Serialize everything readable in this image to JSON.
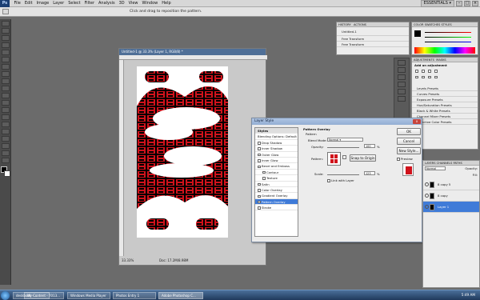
{
  "menubar": {
    "logo": "Ps",
    "items": [
      "File",
      "Edit",
      "Image",
      "Layer",
      "Select",
      "Filter",
      "Analysis",
      "3D",
      "View",
      "Window",
      "Help"
    ],
    "workspace": "ESSENTIALS ▾",
    "win_min": "–",
    "win_max": "□",
    "win_close": "×"
  },
  "optionsbar": {
    "hint": "Click and drag to reposition the pattern."
  },
  "history": {
    "tabs": [
      "HISTORY",
      "ACTIONS"
    ],
    "items": [
      "Untitled-1",
      "Free Transform",
      "Free Transform"
    ]
  },
  "color_panel": {
    "tabs": [
      "COLOR",
      "SWATCHES",
      "STYLES"
    ]
  },
  "adjust_panel": {
    "tabs": [
      "ADJUSTMENTS",
      "MASKS"
    ],
    "header": "Add an adjustment",
    "presets": [
      "Levels Presets",
      "Curves Presets",
      "Exposure Presets",
      "Hue/Saturation Presets",
      "Black & White Presets",
      "Channel Mixer Presets",
      "Selective Color Presets"
    ]
  },
  "document": {
    "title": "Untitled-1 @ 33.3% (Layer 1, RGB/8) *",
    "zoom": "33.33%",
    "docinfo": "Doc: 17.2M/8.98M"
  },
  "layer_style": {
    "title": "Layer Style",
    "close": "x",
    "styles": [
      "Styles",
      "Blending Options: Default",
      "Drop Shadow",
      "Inner Shadow",
      "Outer Glow",
      "Inner Glow",
      "Bevel and Emboss",
      "Contour",
      "Texture",
      "Satin",
      "Color Overlay",
      "Gradient Overlay",
      "Pattern Overlay",
      "Stroke"
    ],
    "selected_index": 12,
    "section_title": "Pattern Overlay",
    "group_label": "Pattern",
    "blend_mode_label": "Blend Mode:",
    "blend_mode_value": "Normal",
    "opacity_label": "Opacity:",
    "opacity_value": "100",
    "opacity_unit": "%",
    "pattern_label": "Pattern:",
    "snap_button": "Snap to Origin",
    "scale_label": "Scale:",
    "scale_value": "123",
    "scale_unit": "%",
    "link_label": "Link with Layer",
    "ok": "OK",
    "cancel": "Cancel",
    "new_style": "New Style...",
    "preview_label": "Preview"
  },
  "layers": {
    "tabs": [
      "LAYERS",
      "CHANNELS",
      "PATHS"
    ],
    "blend_mode": "Normal",
    "opacity_label": "Opacity:",
    "fill_label": "Fill:",
    "rows": [
      "8 copy 5",
      "8 copy",
      "Layer 1"
    ],
    "selected_index": 2
  },
  "taskbar": {
    "tasks": [
      "deskbook - ...",
      "My Content - 7013...",
      "Windows Media Player",
      "Photos Entry 1",
      "Adobe Photoshop C..."
    ],
    "active_index": 4,
    "clock": "5:49 AM"
  },
  "colors": {
    "accent_red": "#d0121b",
    "selection_blue": "#3f7bd8"
  }
}
